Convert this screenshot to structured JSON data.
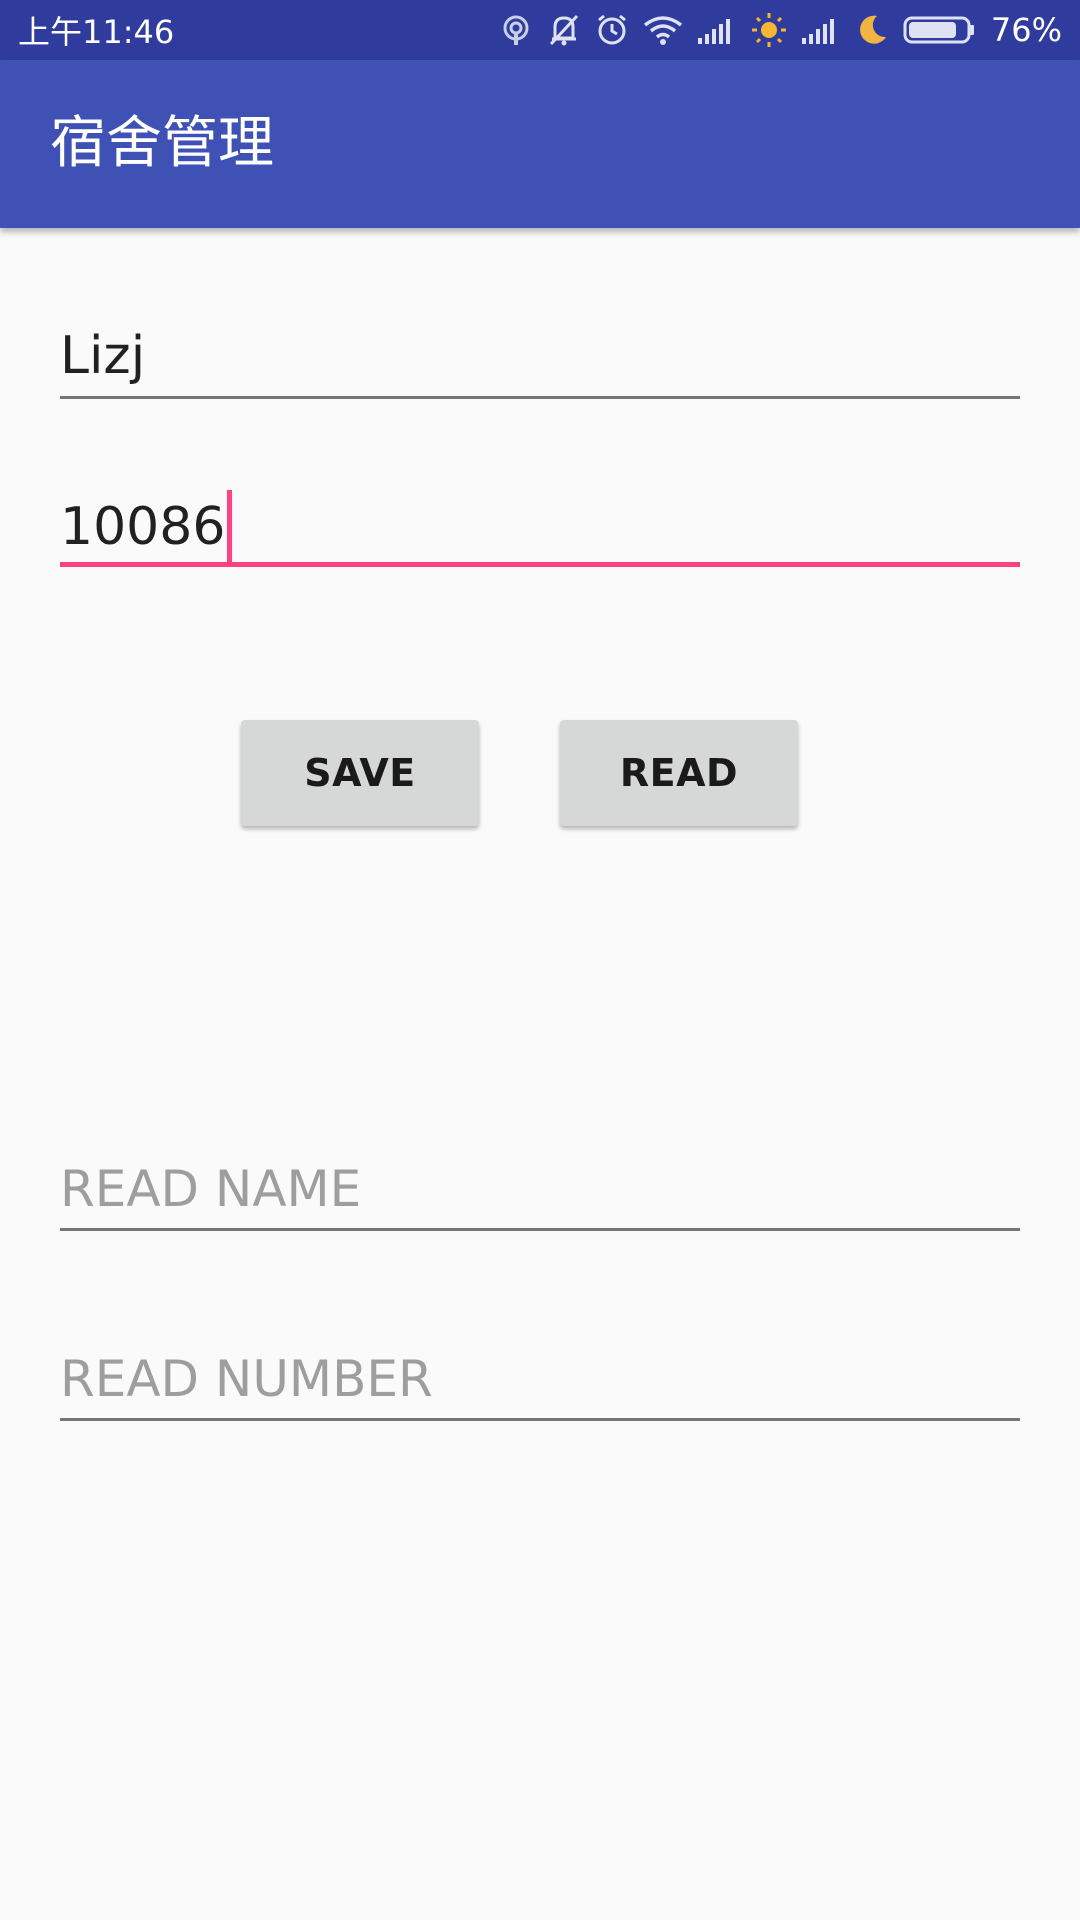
{
  "status_bar": {
    "time": "上午11:46",
    "battery": "76%",
    "icons": [
      "hotspot-icon",
      "bell-off-icon",
      "alarm-icon",
      "wifi-icon",
      "signal-icon",
      "brightness-icon",
      "signal-icon",
      "moon-icon",
      "battery-icon"
    ]
  },
  "app_bar": {
    "title": "宿舍管理",
    "color": "#3f51b5"
  },
  "form": {
    "name_value": "Lizj",
    "number_value": "10086",
    "accent_color": "#ff4081"
  },
  "buttons": {
    "save_label": "SAVE",
    "read_label": "READ"
  },
  "results": {
    "read_name_hint": "READ NAME",
    "read_number_hint": "READ NUMBER"
  }
}
